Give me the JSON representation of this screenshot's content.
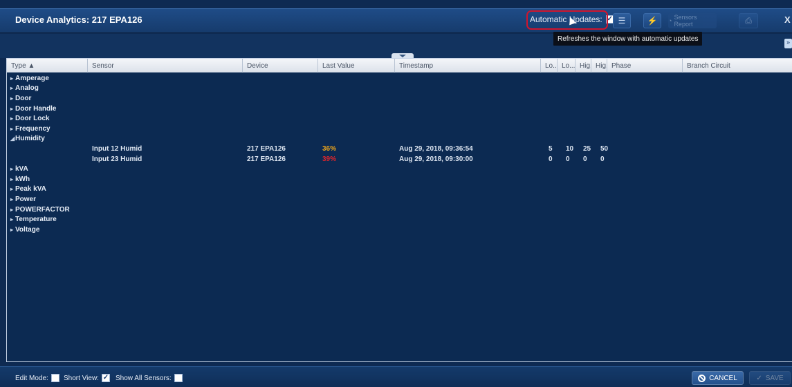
{
  "window": {
    "title": "Device Analytics: 217 EPA126",
    "close_glyph": "X"
  },
  "toolbar": {
    "auto_updates_label": "Automatic Updates:",
    "auto_updates_checked": true,
    "tooltip": "Refreshes the window with automatic updates",
    "sensors_report_label": "Sensors Report",
    "icons": [
      "list-view-icon",
      "chart-icon",
      "sensors-report-icon",
      "print-icon"
    ]
  },
  "table": {
    "columns": [
      "Type ▲",
      "Sensor",
      "Device",
      "Last Value",
      "Timestamp",
      "Lo...",
      "Lo...",
      "Hig...",
      "Hig...",
      "Phase",
      "Branch Circuit"
    ],
    "groups": [
      {
        "label": "Amperage",
        "expanded": false,
        "rows": []
      },
      {
        "label": "Analog",
        "expanded": false,
        "rows": []
      },
      {
        "label": "Door",
        "expanded": false,
        "rows": []
      },
      {
        "label": "Door Handle",
        "expanded": false,
        "rows": []
      },
      {
        "label": "Door Lock",
        "expanded": false,
        "rows": []
      },
      {
        "label": "Frequency",
        "expanded": false,
        "rows": []
      },
      {
        "label": "Humidity",
        "expanded": true,
        "rows": [
          {
            "sensor": "Input 12 Humid",
            "device": "217 EPA126",
            "last_value": "36%",
            "value_color": "#e8a21c",
            "timestamp": "Aug 29, 2018, 09:36:54",
            "lo1": "5",
            "lo2": "10",
            "hi1": "25",
            "hi2": "50"
          },
          {
            "sensor": "Input 23 Humid",
            "device": "217 EPA126",
            "last_value": "39%",
            "value_color": "#e0262b",
            "timestamp": "Aug 29, 2018, 09:30:00",
            "lo1": "0",
            "lo2": "0",
            "hi1": "0",
            "hi2": "0"
          }
        ]
      },
      {
        "label": "kVA",
        "expanded": false,
        "rows": []
      },
      {
        "label": "kWh",
        "expanded": false,
        "rows": []
      },
      {
        "label": "Peak kVA",
        "expanded": false,
        "rows": []
      },
      {
        "label": "Power",
        "expanded": false,
        "rows": []
      },
      {
        "label": "POWERFACTOR",
        "expanded": false,
        "rows": []
      },
      {
        "label": "Temperature",
        "expanded": false,
        "rows": []
      },
      {
        "label": "Voltage",
        "expanded": false,
        "rows": []
      }
    ]
  },
  "footer": {
    "edit_mode_label": "Edit Mode:",
    "edit_mode_checked": false,
    "short_view_label": "Short View:",
    "short_view_checked": true,
    "show_all_label": "Show All Sensors:",
    "show_all_checked": false,
    "cancel_label": "CANCEL",
    "save_label": "SAVE"
  }
}
